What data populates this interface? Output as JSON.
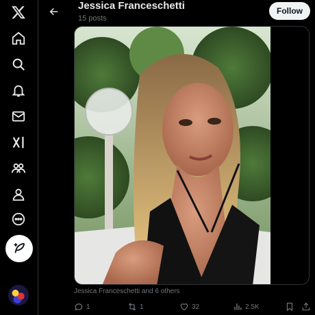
{
  "sidebar": {
    "logo": "x-logo-icon",
    "items": [
      {
        "icon": "home-icon"
      },
      {
        "icon": "search-icon"
      },
      {
        "icon": "bell-icon"
      },
      {
        "icon": "mail-icon"
      },
      {
        "icon": "grok-icon"
      },
      {
        "icon": "communities-icon"
      },
      {
        "icon": "profile-icon"
      },
      {
        "icon": "more-icon"
      }
    ],
    "compose": "compose-icon",
    "avatar": "avatar"
  },
  "header": {
    "name": "Jessica Franceschetti",
    "posts": "15 posts",
    "follow_label": "Follow"
  },
  "post": {
    "tagged": "Jessica Franceschetti and 6 others",
    "replies": "1",
    "reposts": "1",
    "likes": "32",
    "views": "2.5K"
  }
}
